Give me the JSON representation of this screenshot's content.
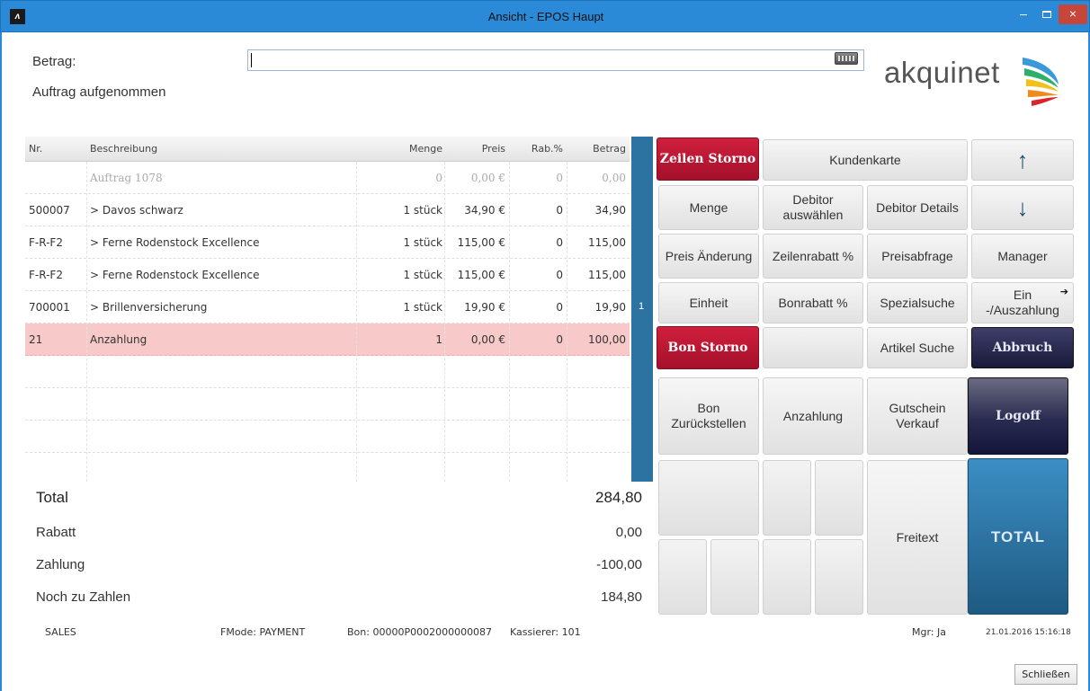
{
  "window": {
    "title": "Ansicht - EPOS Haupt",
    "close": "×"
  },
  "form": {
    "betrag_label": "Betrag:",
    "status": "Auftrag  aufgenommen",
    "betrag_value": ""
  },
  "logo": {
    "text": "akquinet"
  },
  "table": {
    "headers": {
      "nr": "Nr.",
      "desc": "Beschreibung",
      "menge": "Menge",
      "preis": "Preis",
      "rab": "Rab.%",
      "betrag": "Betrag"
    },
    "rows": [
      {
        "nr": "",
        "desc": "Auftrag 1078",
        "menge": "0",
        "preis": "0,00 €",
        "rab": "0",
        "betrag": "0,00"
      },
      {
        "nr": "500007",
        "desc": "> Davos schwarz",
        "menge": "1 stück",
        "preis": "34,90 €",
        "rab": "0",
        "betrag": "34,90"
      },
      {
        "nr": "F-R-F2",
        "desc": "> Ferne Rodenstock Excellence",
        "menge": "1 stück",
        "preis": "115,00 €",
        "rab": "0",
        "betrag": "115,00"
      },
      {
        "nr": "F-R-F2",
        "desc": "> Ferne Rodenstock Excellence",
        "menge": "1 stück",
        "preis": "115,00 €",
        "rab": "0",
        "betrag": "115,00"
      },
      {
        "nr": "700001",
        "desc": "> Brillenversicherung",
        "menge": "1 stück",
        "preis": "19,90 €",
        "rab": "0",
        "betrag": "19,90"
      },
      {
        "nr": "21",
        "desc": "Anzahlung",
        "menge": "1",
        "preis": "0,00 €",
        "rab": "0",
        "betrag": "100,00"
      }
    ],
    "scroll_marker": "1"
  },
  "totals": {
    "total_label": "Total",
    "total_value": "284,80",
    "rabatt_label": "Rabatt",
    "rabatt_value": "0,00",
    "zahlung_label": "Zahlung",
    "zahlung_value": "-100,00",
    "noch_label": "Noch zu Zahlen",
    "noch_value": "184,80"
  },
  "status": {
    "mode": "SALES",
    "fmode": "FMode: PAYMENT",
    "bon": "Bon: 00000P0002000000087",
    "kassierer": "Kassierer: 101",
    "mgr": "Mgr: Ja",
    "datetime": "21.01.2016 15:16:18"
  },
  "buttons": {
    "zeilen_storno": "Zeilen Storno",
    "kundenkarte": "Kundenkarte",
    "up": "↑",
    "menge": "Menge",
    "debitor_auswaehlen": "Debitor auswählen",
    "debitor_details": "Debitor Details",
    "down": "↓",
    "preis_aenderung": "Preis Änderung",
    "zeilenrabatt": "Zeilenrabatt %",
    "preisabfrage": "Preisabfrage",
    "manager": "Manager",
    "einheit": "Einheit",
    "bonrabatt": "Bonrabatt %",
    "spezialsuche": "Spezialsuche",
    "ein_auszahlung": "Ein -/Auszahlung",
    "bon_storno": "Bon Storno",
    "artikel_suche": "Artikel Suche",
    "abbruch": "Abbruch",
    "bon_zurueckstellen": "Bon Zurückstellen",
    "anzahlung": "Anzahlung",
    "gutschein_verkauf": "Gutschein Verkauf",
    "logoff": "Logoff",
    "freitext": "Freitext",
    "total": "TOTAL",
    "schliessen": "Schließen"
  },
  "colors": {
    "titlebar": "#2b8ad8",
    "storno_red": "#c0183a",
    "dark_navy": "#1f2046",
    "total_blue": "#2b6f9e",
    "highlight_row": "#f7c9c9"
  }
}
